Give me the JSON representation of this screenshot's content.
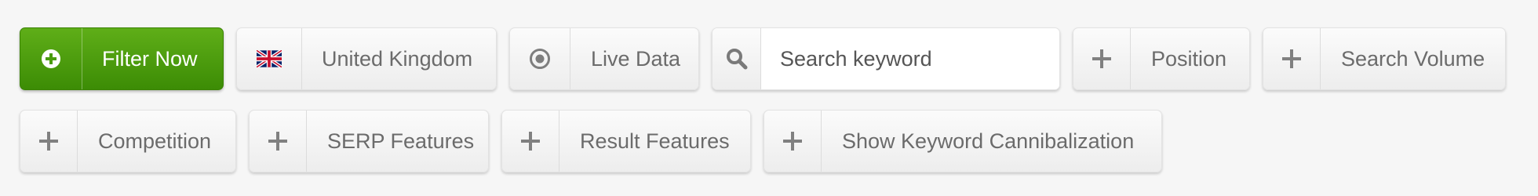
{
  "filter_bar": {
    "filter_now": {
      "label": "Filter Now",
      "icon": "plus-circle-icon",
      "color": "#4a9c0d"
    },
    "country": {
      "label": "United Kingdom",
      "icon": "uk-flag-icon"
    },
    "data_source": {
      "label": "Live Data",
      "icon": "radio-dot-icon"
    },
    "search": {
      "placeholder": "Search keyword",
      "value": "",
      "icon": "search-icon"
    },
    "filters": [
      {
        "label": "Position",
        "icon": "plus-icon"
      },
      {
        "label": "Search Volume",
        "icon": "plus-icon"
      },
      {
        "label": "Competition",
        "icon": "plus-icon"
      },
      {
        "label": "SERP Features",
        "icon": "plus-icon"
      },
      {
        "label": "Result Features",
        "icon": "plus-icon"
      },
      {
        "label": "Show Keyword Cannibalization",
        "icon": "plus-icon"
      }
    ]
  }
}
